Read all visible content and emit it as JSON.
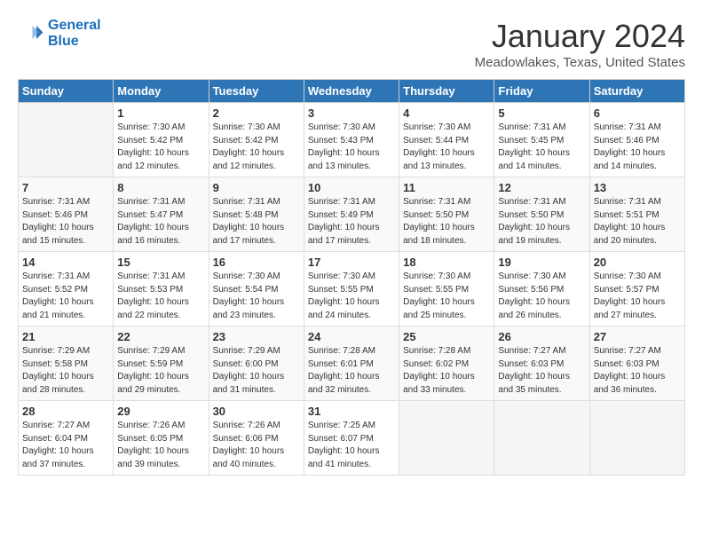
{
  "logo": {
    "line1": "General",
    "line2": "Blue"
  },
  "title": "January 2024",
  "subtitle": "Meadowlakes, Texas, United States",
  "headers": [
    "Sunday",
    "Monday",
    "Tuesday",
    "Wednesday",
    "Thursday",
    "Friday",
    "Saturday"
  ],
  "weeks": [
    [
      {
        "day": "",
        "info": ""
      },
      {
        "day": "1",
        "info": "Sunrise: 7:30 AM\nSunset: 5:42 PM\nDaylight: 10 hours\nand 12 minutes."
      },
      {
        "day": "2",
        "info": "Sunrise: 7:30 AM\nSunset: 5:42 PM\nDaylight: 10 hours\nand 12 minutes."
      },
      {
        "day": "3",
        "info": "Sunrise: 7:30 AM\nSunset: 5:43 PM\nDaylight: 10 hours\nand 13 minutes."
      },
      {
        "day": "4",
        "info": "Sunrise: 7:30 AM\nSunset: 5:44 PM\nDaylight: 10 hours\nand 13 minutes."
      },
      {
        "day": "5",
        "info": "Sunrise: 7:31 AM\nSunset: 5:45 PM\nDaylight: 10 hours\nand 14 minutes."
      },
      {
        "day": "6",
        "info": "Sunrise: 7:31 AM\nSunset: 5:46 PM\nDaylight: 10 hours\nand 14 minutes."
      }
    ],
    [
      {
        "day": "7",
        "info": "Sunrise: 7:31 AM\nSunset: 5:46 PM\nDaylight: 10 hours\nand 15 minutes."
      },
      {
        "day": "8",
        "info": "Sunrise: 7:31 AM\nSunset: 5:47 PM\nDaylight: 10 hours\nand 16 minutes."
      },
      {
        "day": "9",
        "info": "Sunrise: 7:31 AM\nSunset: 5:48 PM\nDaylight: 10 hours\nand 17 minutes."
      },
      {
        "day": "10",
        "info": "Sunrise: 7:31 AM\nSunset: 5:49 PM\nDaylight: 10 hours\nand 17 minutes."
      },
      {
        "day": "11",
        "info": "Sunrise: 7:31 AM\nSunset: 5:50 PM\nDaylight: 10 hours\nand 18 minutes."
      },
      {
        "day": "12",
        "info": "Sunrise: 7:31 AM\nSunset: 5:50 PM\nDaylight: 10 hours\nand 19 minutes."
      },
      {
        "day": "13",
        "info": "Sunrise: 7:31 AM\nSunset: 5:51 PM\nDaylight: 10 hours\nand 20 minutes."
      }
    ],
    [
      {
        "day": "14",
        "info": "Sunrise: 7:31 AM\nSunset: 5:52 PM\nDaylight: 10 hours\nand 21 minutes."
      },
      {
        "day": "15",
        "info": "Sunrise: 7:31 AM\nSunset: 5:53 PM\nDaylight: 10 hours\nand 22 minutes."
      },
      {
        "day": "16",
        "info": "Sunrise: 7:30 AM\nSunset: 5:54 PM\nDaylight: 10 hours\nand 23 minutes."
      },
      {
        "day": "17",
        "info": "Sunrise: 7:30 AM\nSunset: 5:55 PM\nDaylight: 10 hours\nand 24 minutes."
      },
      {
        "day": "18",
        "info": "Sunrise: 7:30 AM\nSunset: 5:55 PM\nDaylight: 10 hours\nand 25 minutes."
      },
      {
        "day": "19",
        "info": "Sunrise: 7:30 AM\nSunset: 5:56 PM\nDaylight: 10 hours\nand 26 minutes."
      },
      {
        "day": "20",
        "info": "Sunrise: 7:30 AM\nSunset: 5:57 PM\nDaylight: 10 hours\nand 27 minutes."
      }
    ],
    [
      {
        "day": "21",
        "info": "Sunrise: 7:29 AM\nSunset: 5:58 PM\nDaylight: 10 hours\nand 28 minutes."
      },
      {
        "day": "22",
        "info": "Sunrise: 7:29 AM\nSunset: 5:59 PM\nDaylight: 10 hours\nand 29 minutes."
      },
      {
        "day": "23",
        "info": "Sunrise: 7:29 AM\nSunset: 6:00 PM\nDaylight: 10 hours\nand 31 minutes."
      },
      {
        "day": "24",
        "info": "Sunrise: 7:28 AM\nSunset: 6:01 PM\nDaylight: 10 hours\nand 32 minutes."
      },
      {
        "day": "25",
        "info": "Sunrise: 7:28 AM\nSunset: 6:02 PM\nDaylight: 10 hours\nand 33 minutes."
      },
      {
        "day": "26",
        "info": "Sunrise: 7:27 AM\nSunset: 6:03 PM\nDaylight: 10 hours\nand 35 minutes."
      },
      {
        "day": "27",
        "info": "Sunrise: 7:27 AM\nSunset: 6:03 PM\nDaylight: 10 hours\nand 36 minutes."
      }
    ],
    [
      {
        "day": "28",
        "info": "Sunrise: 7:27 AM\nSunset: 6:04 PM\nDaylight: 10 hours\nand 37 minutes."
      },
      {
        "day": "29",
        "info": "Sunrise: 7:26 AM\nSunset: 6:05 PM\nDaylight: 10 hours\nand 39 minutes."
      },
      {
        "day": "30",
        "info": "Sunrise: 7:26 AM\nSunset: 6:06 PM\nDaylight: 10 hours\nand 40 minutes."
      },
      {
        "day": "31",
        "info": "Sunrise: 7:25 AM\nSunset: 6:07 PM\nDaylight: 10 hours\nand 41 minutes."
      },
      {
        "day": "",
        "info": ""
      },
      {
        "day": "",
        "info": ""
      },
      {
        "day": "",
        "info": ""
      }
    ]
  ]
}
